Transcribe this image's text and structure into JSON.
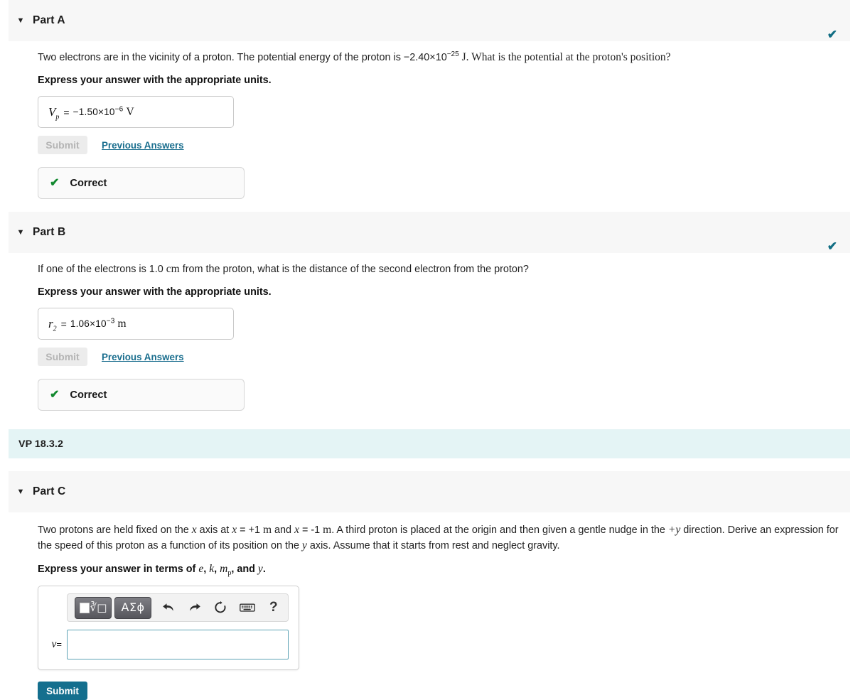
{
  "parts": {
    "a": {
      "title": "Part A",
      "question_pre": "Two electrons are in the vicinity of a proton. The potential energy of the proton is −2.40×10",
      "question_exp": "−25",
      "question_post": " J. What is the potential at the proton's position?",
      "instruction": "Express your answer with the appropriate units.",
      "answer_var": "V",
      "answer_var_sub": "p",
      "answer_eq": "=",
      "answer_value_pre": "−1.50×10",
      "answer_value_exp": "−6",
      "answer_unit": "V",
      "submit_label": "Submit",
      "previous_answers_label": "Previous Answers",
      "status_label": "Correct",
      "status_icon": "check-icon",
      "header_check_icon": "check-icon"
    },
    "b": {
      "title": "Part B",
      "question_pre": "If one of the electrons is 1.0 ",
      "question_unit": "cm",
      "question_post": " from the proton, what is the distance of the second electron from the proton?",
      "instruction": "Express your answer with the appropriate units.",
      "answer_var": "r",
      "answer_var_sub": "2",
      "answer_eq": "=",
      "answer_value_pre": "1.06×10",
      "answer_value_exp": "−3",
      "answer_unit": "m",
      "submit_label": "Submit",
      "previous_answers_label": "Previous Answers",
      "status_label": "Correct",
      "status_icon": "check-icon",
      "header_check_icon": "check-icon"
    },
    "c": {
      "title": "Part C",
      "question_line1_a": "Two protons are held fixed on the ",
      "question_line1_x1": "x",
      "question_line1_b": " axis at ",
      "question_line1_x2": "x",
      "question_line1_c": " = +1 ",
      "question_line1_m1": "m",
      "question_line1_d": " and ",
      "question_line1_x3": "x",
      "question_line1_e": " = -1 ",
      "question_line1_m2": "m",
      "question_line1_f": ". A third proton is placed at the origin and then given a gentle nudge in the ",
      "question_line1_plusy": "+y",
      "question_line1_g": " direction. Derive an expression for the speed of",
      "question_line2_a": "this proton as a function of its position on the ",
      "question_line2_y": "y",
      "question_line2_b": " axis. Assume that it starts from rest and neglect gravity.",
      "instruction_a": "Express your answer in terms of ",
      "instruction_e": "e",
      "instruction_comma1": ", ",
      "instruction_k": "k",
      "instruction_comma2": ", ",
      "instruction_m": "m",
      "instruction_m_sub": "p",
      "instruction_and": ", and ",
      "instruction_y": "y",
      "instruction_period": ".",
      "input_var": "v",
      "input_eq": "=",
      "input_value": "",
      "submit_label": "Submit",
      "toolbar": {
        "template_button_icon": "math-template-icon",
        "greek_button_label": "ΑΣϕ",
        "greek_button_icon": "greek-symbols-icon",
        "undo_icon": "undo-icon",
        "redo_icon": "redo-icon",
        "reset_icon": "reset-icon",
        "keyboard_icon": "keyboard-icon",
        "help_icon": "help-icon",
        "help_label": "?"
      }
    }
  },
  "vp_banner": {
    "label": "VP 18.3.2"
  },
  "colors": {
    "header_band": "#f7f7f7",
    "vp_band": "#e4f4f5",
    "teal_check": "#126e84",
    "green_check": "#12892f",
    "link": "#1a6e8e",
    "submit_active": "#146f8e",
    "input_border": "#5ea3b5"
  }
}
